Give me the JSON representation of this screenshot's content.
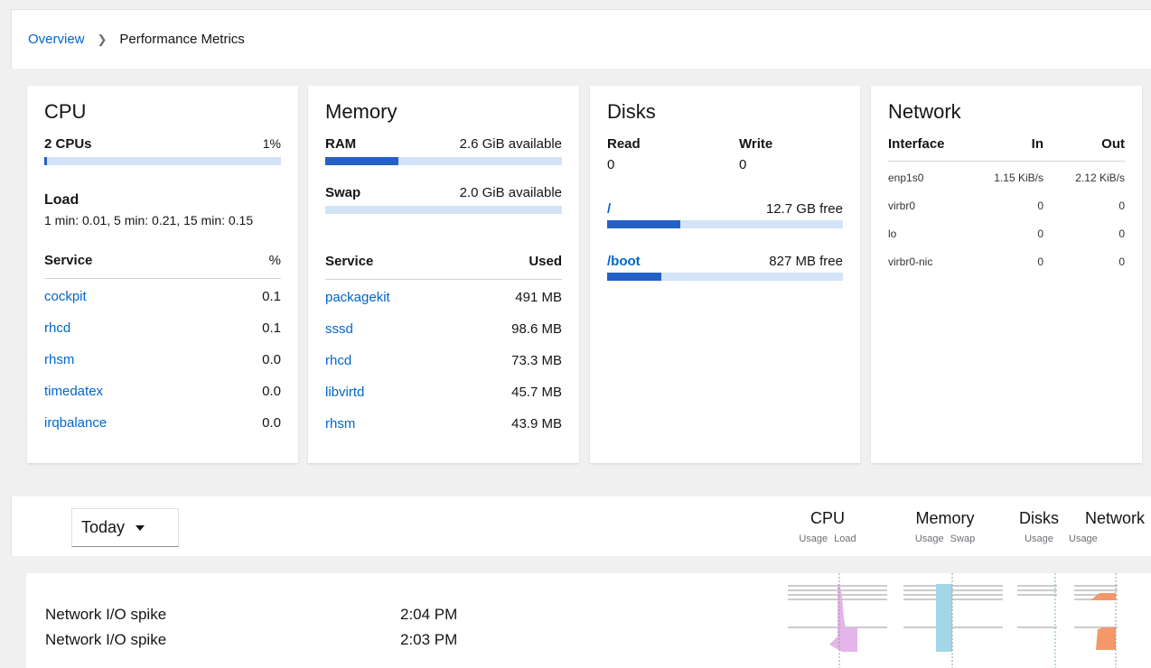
{
  "breadcrumb": {
    "parent": "Overview",
    "current": "Performance Metrics"
  },
  "cpu": {
    "title": "CPU",
    "count_label": "2 CPUs",
    "usage_label": "1%",
    "usage_fraction": 0.01,
    "load_label": "Load",
    "load_value": "1 min: 0.01, 5 min: 0.21, 15 min: 0.15",
    "service_header": "Service",
    "value_header": "%",
    "services": [
      {
        "name": "cockpit",
        "value": "0.1"
      },
      {
        "name": "rhcd",
        "value": "0.1"
      },
      {
        "name": "rhsm",
        "value": "0.0"
      },
      {
        "name": "timedatex",
        "value": "0.0"
      },
      {
        "name": "irqbalance",
        "value": "0.0"
      }
    ]
  },
  "memory": {
    "title": "Memory",
    "ram_label": "RAM",
    "ram_value": "2.6 GiB available",
    "ram_fraction": 0.31,
    "swap_label": "Swap",
    "swap_value": "2.0 GiB available",
    "swap_fraction": 0.0,
    "service_header": "Service",
    "value_header": "Used",
    "services": [
      {
        "name": "packagekit",
        "value": "491 MB"
      },
      {
        "name": "sssd",
        "value": "98.6 MB"
      },
      {
        "name": "rhcd",
        "value": "73.3 MB"
      },
      {
        "name": "libvirtd",
        "value": "45.7 MB"
      },
      {
        "name": "rhsm",
        "value": "43.9 MB"
      }
    ]
  },
  "disks": {
    "title": "Disks",
    "read_label": "Read",
    "read_value": "0",
    "write_label": "Write",
    "write_value": "0",
    "mounts": [
      {
        "path": "/",
        "free": "12.7 GB free",
        "fraction": 0.31
      },
      {
        "path": "/boot",
        "free": "827 MB free",
        "fraction": 0.23
      }
    ]
  },
  "network": {
    "title": "Network",
    "headers": [
      "Interface",
      "In",
      "Out"
    ],
    "rows": [
      [
        "enp1s0",
        "1.15 KiB/s",
        "2.12 KiB/s"
      ],
      [
        "virbr0",
        "0",
        "0"
      ],
      [
        "lo",
        "0",
        "0"
      ],
      [
        "virbr0-nic",
        "0",
        "0"
      ]
    ]
  },
  "toolbar": {
    "range_value": "Today",
    "columns": [
      {
        "title": "CPU",
        "sub": "Usage Load"
      },
      {
        "title": "Memory",
        "sub": "Usage Swap"
      },
      {
        "title": "Disks",
        "sub": "Usage"
      },
      {
        "title": "Network",
        "sub": "Usage"
      }
    ]
  },
  "events": [
    {
      "label": "Network I/O spike",
      "time": "2:04 PM"
    },
    {
      "label": "Network I/O spike",
      "time": "2:03 PM"
    }
  ],
  "colors": {
    "link": "#0066cc",
    "bar_fill": "#2461c6",
    "bar_track": "#d2e4f6",
    "cpu_spark": "#e3b5e8",
    "memory_spark": "#a3d6e6",
    "network_spark": "#f4976a"
  }
}
